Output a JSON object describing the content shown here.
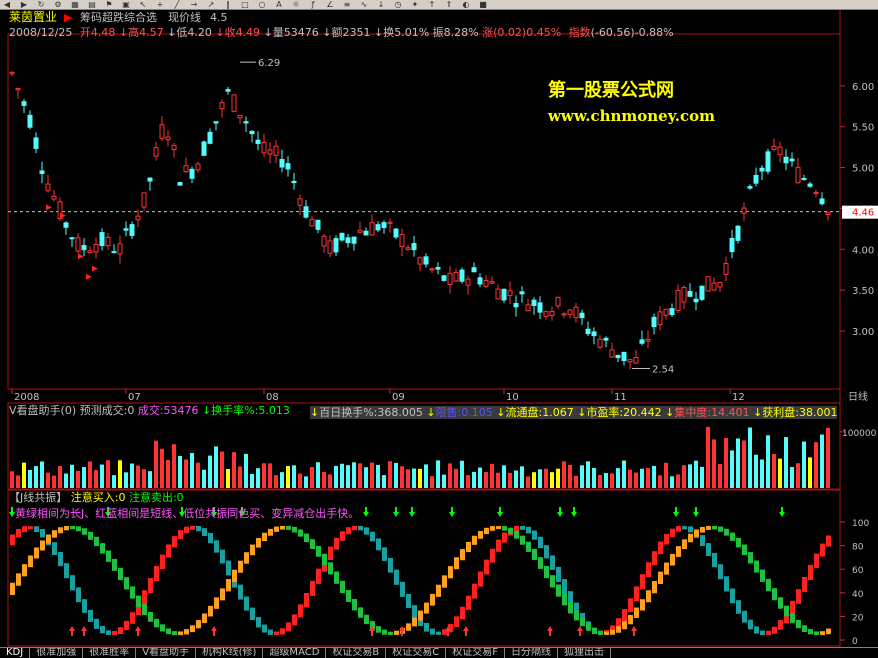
{
  "toolbar": {
    "icons": [
      "back-icon",
      "forward-icon",
      "refresh-icon",
      "gear-icon",
      "chart-icon",
      "grid-icon",
      "flag-icon",
      "book-icon",
      "cursor-icon",
      "plus-icon",
      "line-icon",
      "arrow-icon",
      "ray-icon",
      "channel-icon",
      "rect-icon",
      "circle-icon",
      "text-icon",
      "sun-icon",
      "fib-icon",
      "angle-icon",
      "parallel-icon",
      "wave-icon",
      "down-arrow-icon",
      "cycle-icon",
      "mark-icon",
      "up-icon",
      "up2-icon",
      "color-icon",
      "save-icon"
    ]
  },
  "header": {
    "stock_name": "莱茵置业",
    "indicator_name": "筹码超跌综合选",
    "price_label": "现价线",
    "price_value": "4.5",
    "date": "2008/12/25",
    "open_label": "开",
    "open": "4.48",
    "high_label": "高",
    "high": "4.57",
    "low_label": "低",
    "low": "4.20",
    "close_label": "收",
    "close": "4.49",
    "volume_label": "量",
    "volume": "53476",
    "amount_label": "额",
    "amount": "2351",
    "turnover_label": "换",
    "turnover": "5.01%",
    "amplitude_label": "振",
    "amplitude": "8.28%",
    "change_label": "涨",
    "change": "(0.02)",
    "change_pct": "0.45%",
    "index_label": "指数",
    "index_change": "(-60.56)",
    "index_pct": "-0.88%"
  },
  "watermark": {
    "line1": "第一股票公式网",
    "line2": "www.chnmoney.com"
  },
  "price_panel": {
    "high_mark": "6.29",
    "low_mark": "2.54",
    "current_tag": "4.46",
    "y_ticks": [
      "6.00",
      "5.50",
      "5.00",
      "4.50",
      "4.00",
      "3.50",
      "3.00"
    ],
    "period_label": "日线",
    "months": [
      "2008",
      "07",
      "08",
      "09",
      "10",
      "11",
      "12"
    ]
  },
  "volume_panel": {
    "title": "V看盘助手(0)",
    "predict_label": "预测成交:0",
    "volume_text": "成交:53476",
    "turnover_text": "换手率%:5.013",
    "hundred_turnover": "百日换手%:368.005",
    "float_text": "限售:0.105",
    "circulation_text": "流通盘:1.067",
    "pe_text": "市盈率:20.442",
    "concentration_text": "集中度:14.401",
    "profit_text": "获利盘:38.001",
    "y_tick": "100000",
    "colors": {
      "up": "#ff3333",
      "down": "#54fcfc",
      "limit": "#ffff00"
    }
  },
  "osc_panel": {
    "title": "【J线共振】",
    "buy_label": "注意买入:0",
    "sell_label": "注意卖出:0",
    "note": "黄绿相间为长J、红蓝相间是短线、低位共振同色买、变异减仓出手快。",
    "y_ticks": [
      "100",
      "80",
      "60",
      "40",
      "20",
      "0"
    ]
  },
  "tabs": [
    "KDJ",
    "很准加强",
    "很准胜率",
    "V看盘助手",
    "机构K线(修)",
    "超级MACD",
    "权证交易B",
    "权证交易C",
    "权证交易F",
    "日分隔线",
    "狐狸出击"
  ]
}
